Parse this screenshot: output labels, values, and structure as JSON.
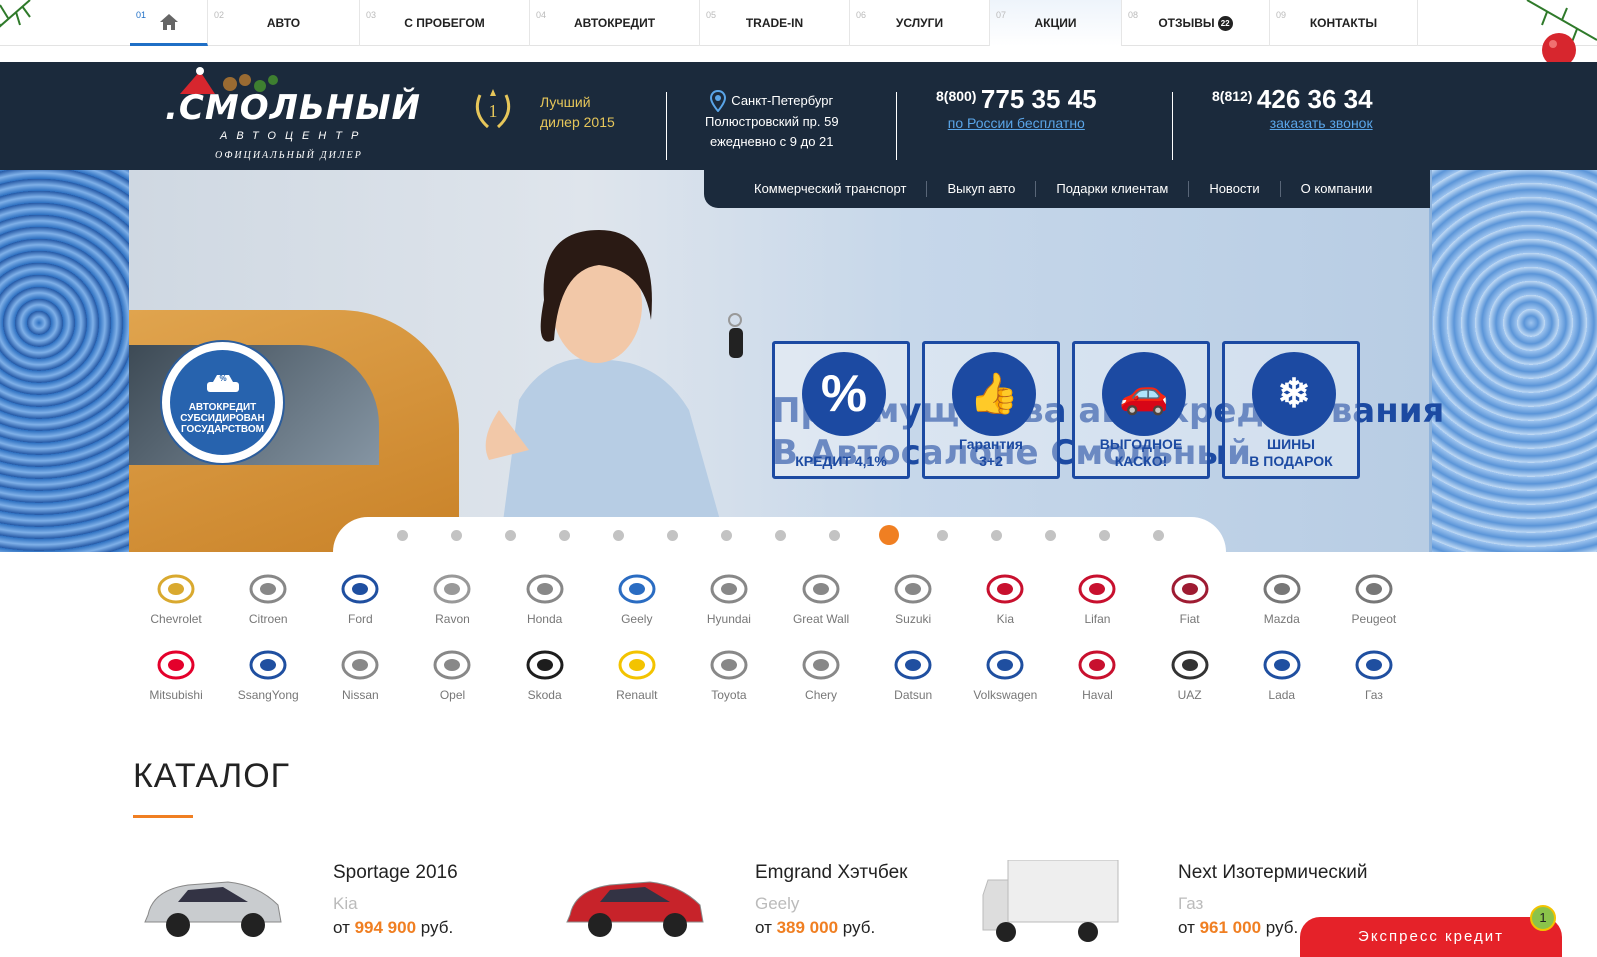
{
  "nav": {
    "items": [
      {
        "num": "01",
        "label": "",
        "icon": "home-icon"
      },
      {
        "num": "02",
        "label": "АВТО"
      },
      {
        "num": "03",
        "label": "С ПРОБЕГОМ"
      },
      {
        "num": "04",
        "label": "АВТОКРЕДИТ"
      },
      {
        "num": "05",
        "label": "TRADE-IN"
      },
      {
        "num": "06",
        "label": "УСЛУГИ"
      },
      {
        "num": "07",
        "label": "АКЦИИ"
      },
      {
        "num": "08",
        "label": "ОТЗЫВЫ",
        "badge": "22"
      },
      {
        "num": "09",
        "label": "КОНТАКТЫ"
      }
    ]
  },
  "header": {
    "logo_word": ".СМОЛЬНЫЙ",
    "logo_sub": "АВТОЦЕНТР",
    "logo_sub2": "ОФИЦИАЛЬНЫЙ ДИЛЕР",
    "award_num": "1",
    "award_line1": "Лучший",
    "award_line2": "дилер 2015",
    "city": "Санкт-Петербург",
    "address": "Полюстровский пр. 59",
    "hours": "ежедневно с 9 до 21",
    "phone1_prefix": "8(800)",
    "phone1_number": "775 35 45",
    "phone1_link": "по России бесплатно",
    "phone2_prefix": "8(812)",
    "phone2_number": "426 36 34",
    "phone2_link": "заказать звонок"
  },
  "submenu": [
    "Коммерческий транспорт",
    "Выкуп авто",
    "Подарки клиентам",
    "Новости",
    "О компании"
  ],
  "hero": {
    "title_line1": "Преимущества автокредитования",
    "title_line2": "В Автосалоне Смольный",
    "gov_badge_line1": "АВТОКРЕДИТ",
    "gov_badge_line2": "СУБСИДИРОВАН",
    "gov_badge_line3": "ГОСУДАРСТВОМ",
    "tiles": [
      {
        "symbol": "%",
        "line1": "КРЕДИТ 4,1%",
        "line2": ""
      },
      {
        "symbol": "👍",
        "line1": "Гарантия",
        "line2": "3+2"
      },
      {
        "symbol": "🚗",
        "line1": "ВЫГОДНОЕ",
        "line2": "КАСКО!"
      },
      {
        "symbol": "❄",
        "line1": "ШИНЫ",
        "line2": "В ПОДАРОК"
      }
    ],
    "slide_count": 15,
    "active_slide": 10
  },
  "brands_row1": [
    "Chevrolet",
    "Citroen",
    "Ford",
    "Ravon",
    "Honda",
    "Geely",
    "Hyundai",
    "Great Wall",
    "Suzuki",
    "Kia",
    "Lifan",
    "Fiat",
    "Mazda",
    "Peugeot"
  ],
  "brands_row2": [
    "Mitsubishi",
    "SsangYong",
    "Nissan",
    "Opel",
    "Skoda",
    "Renault",
    "Toyota",
    "Chery",
    "Datsun",
    "Volkswagen",
    "Haval",
    "UAZ",
    "Lada",
    "Газ"
  ],
  "catalog": {
    "title": "КАТАЛОГ",
    "products": [
      {
        "name": "Sportage 2016",
        "brand": "Kia",
        "price_prefix": "от",
        "price": "994 900",
        "currency": "руб.",
        "color": "#c9cccf"
      },
      {
        "name": "Emgrand Хэтчбек",
        "brand": "Geely",
        "price_prefix": "от",
        "price": "389 000",
        "currency": "руб.",
        "color": "#c7232a"
      },
      {
        "name": "Next Изотермический",
        "brand": "Газ",
        "price_prefix": "от",
        "price": "961 000",
        "currency": "руб.",
        "color": "#eeeeee"
      }
    ]
  },
  "express": {
    "label": "Экспресс кредит",
    "count": "1"
  },
  "colors": {
    "accent": "#f07f22",
    "navy": "#1b2a3c",
    "blue": "#1c4aa2",
    "link": "#5aa5e8",
    "red": "#e52229"
  }
}
